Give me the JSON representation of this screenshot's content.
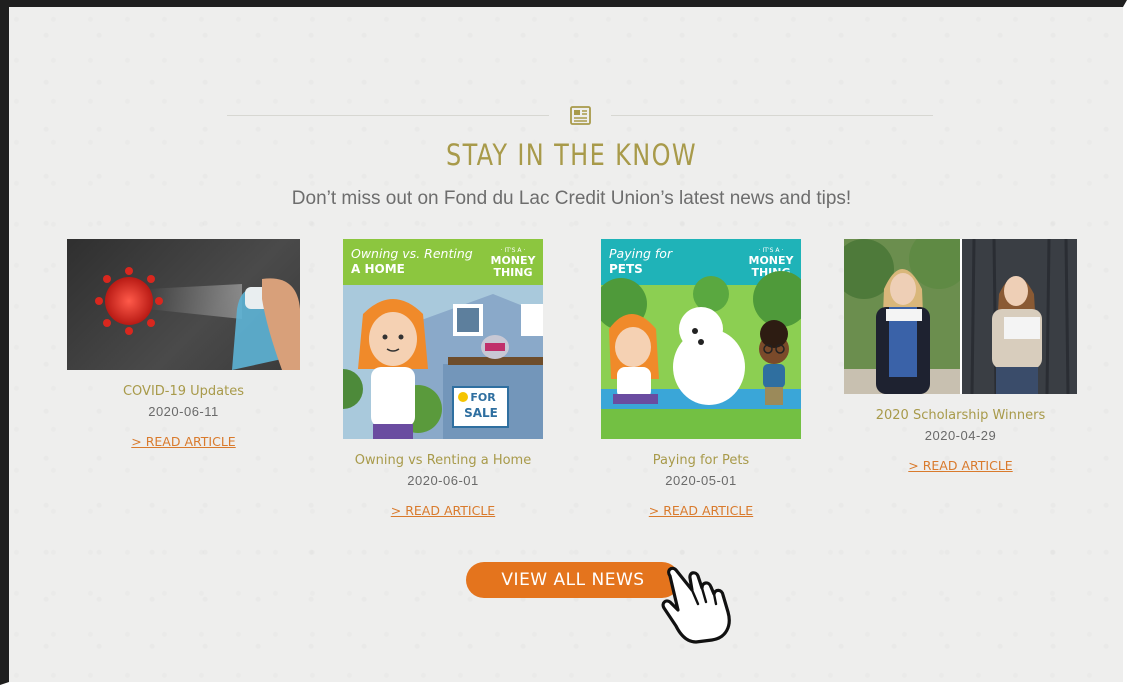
{
  "section": {
    "title": "STAY IN THE KNOW",
    "subtitle": "Don’t miss out on Fond du Lac Credit Union’s latest news and tips!",
    "icon": "newspaper-icon"
  },
  "articles": [
    {
      "title": "COVID-19 Updates",
      "date": "2020-06-11",
      "link": "> READ ARTICLE",
      "image": "virus-spray-photo"
    },
    {
      "title": "Owning vs Renting a Home",
      "date": "2020-06-01",
      "link": "> READ ARTICLE",
      "image": "owning-vs-renting-illustration",
      "image_heading": "Owning vs. Renting",
      "image_subheading": "A HOME",
      "badge_top": "· IT'S A ·",
      "badge_main": "MONEY",
      "badge_bottom": "THING",
      "sign_top": "FOR",
      "sign_bottom": "SALE"
    },
    {
      "title": "Paying for Pets",
      "date": "2020-05-01",
      "link": "> READ ARTICLE",
      "image": "paying-for-pets-illustration",
      "image_heading": "Paying for",
      "image_subheading": "PETS",
      "badge_top": "· IT'S A ·",
      "badge_main": "MONEY",
      "badge_bottom": "THING"
    },
    {
      "title": "2020 Scholarship Winners",
      "date": "2020-04-29",
      "link": "> READ ARTICLE",
      "image": "scholarship-winners-photo"
    }
  ],
  "view_all_button": "VIEW ALL NEWS",
  "colors": {
    "accent": "#e4741d",
    "gold": "#a89a4a",
    "link": "#d97a2c"
  }
}
